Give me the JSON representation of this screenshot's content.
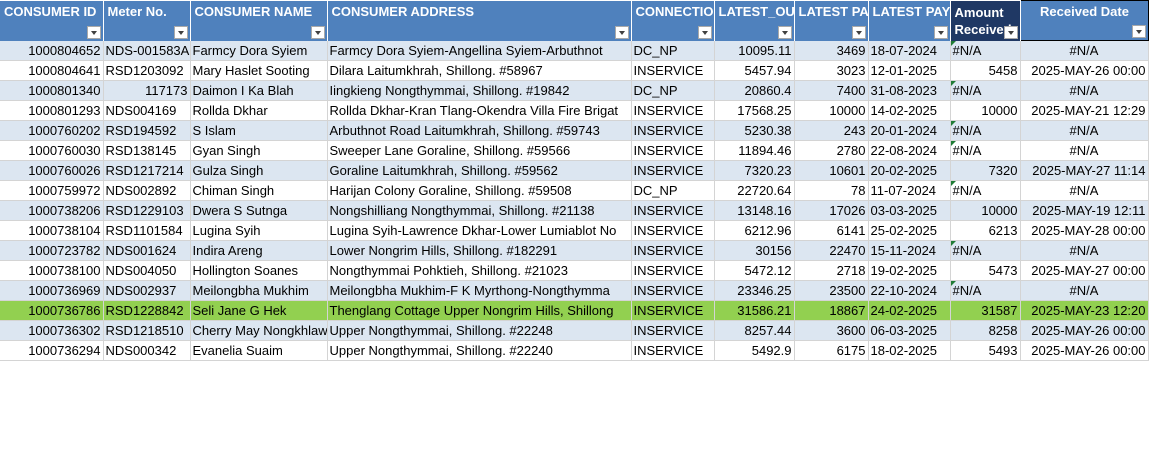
{
  "columns": [
    {
      "label": "CONSUMER ID"
    },
    {
      "label": "Meter No."
    },
    {
      "label": "CONSUMER NAME"
    },
    {
      "label": "CONSUMER ADDRESS"
    },
    {
      "label": "CONNECTION"
    },
    {
      "label": "LATEST_OUT"
    },
    {
      "label": "LATEST PAY"
    },
    {
      "label": "LATEST PAYM"
    },
    {
      "label": "Amount Received"
    },
    {
      "label": "Received Date"
    }
  ],
  "rows": [
    {
      "id": "1000804652",
      "meter": "NDS-001583A",
      "name": "Farmcy Dora Syiem",
      "address": "Farmcy Dora Syiem-Angellina Syiem-Arbuthnot",
      "conn": "DC_NP",
      "out": "10095.11",
      "pay": "3469",
      "date": "18-07-2024",
      "amount": "#N/A",
      "received": "#N/A"
    },
    {
      "id": "1000804641",
      "meter": "RSD1203092",
      "name": "Mary Haslet Sooting",
      "address": "Dilara Laitumkhrah, Shillong.  #58967",
      "conn": "INSERVICE",
      "out": "5457.94",
      "pay": "3023",
      "date": "12-01-2025",
      "amount": "5458",
      "received": "2025-MAY-26 00:00"
    },
    {
      "id": "1000801340",
      "meter": "117173",
      "name": "Daimon I Ka Blah",
      "address": "Iingkieng Nongthymmai, Shillong.  #19842",
      "conn": "DC_NP",
      "out": "20860.4",
      "pay": "7400",
      "date": "31-08-2023",
      "amount": "#N/A",
      "received": "#N/A"
    },
    {
      "id": "1000801293",
      "meter": "NDS004169",
      "name": "Rollda Dkhar",
      "address": "Rollda Dkhar-Kran Tlang-Okendra Villa Fire Brigat",
      "conn": "INSERVICE",
      "out": "17568.25",
      "pay": "10000",
      "date": "14-02-2025",
      "amount": "10000",
      "received": "2025-MAY-21 12:29"
    },
    {
      "id": "1000760202",
      "meter": "RSD194592",
      "name": "S  Islam",
      "address": "Arbuthnot Road Laitumkhrah, Shillong.  #59743",
      "conn": "INSERVICE",
      "out": "5230.38",
      "pay": "243",
      "date": "20-01-2024",
      "amount": "#N/A",
      "received": "#N/A"
    },
    {
      "id": "1000760030",
      "meter": "RSD138145",
      "name": "Gyan  Singh",
      "address": "Sweeper Lane Goraline, Shillong.  #59566",
      "conn": "INSERVICE",
      "out": "11894.46",
      "pay": "2780",
      "date": "22-08-2024",
      "amount": "#N/A",
      "received": "#N/A"
    },
    {
      "id": "1000760026",
      "meter": "RSD1217214",
      "name": "Gulza  Singh",
      "address": "Goraline Laitumkhrah, Shillong.  #59562",
      "conn": "INSERVICE",
      "out": "7320.23",
      "pay": "10601",
      "date": "20-02-2025",
      "amount": "7320",
      "received": "2025-MAY-27 11:14"
    },
    {
      "id": "1000759972",
      "meter": "NDS002892",
      "name": "Chiman  Singh",
      "address": "Harijan Colony Goraline, Shillong.  #59508",
      "conn": "DC_NP",
      "out": "22720.64",
      "pay": "78",
      "date": "11-07-2024",
      "amount": "#N/A",
      "received": "#N/A"
    },
    {
      "id": "1000738206",
      "meter": "RSD1229103",
      "name": "Dwera S Sutnga",
      "address": "Nongshilliang Nongthymmai, Shillong.  #21138",
      "conn": "INSERVICE",
      "out": "13148.16",
      "pay": "17026",
      "date": "03-03-2025",
      "amount": "10000",
      "received": "2025-MAY-19 12:11"
    },
    {
      "id": "1000738104",
      "meter": "RSD1101584",
      "name": "Lugina Syih",
      "address": "Lugina Syih-Lawrence Dkhar-Lower Lumiablot No",
      "conn": "INSERVICE",
      "out": "6212.96",
      "pay": "6141",
      "date": "25-02-2025",
      "amount": "6213",
      "received": "2025-MAY-28 00:00"
    },
    {
      "id": "1000723782",
      "meter": "NDS001624",
      "name": "Indira  Areng",
      "address": "Lower Nongrim Hills, Shillong.  #182291",
      "conn": "INSERVICE",
      "out": "30156",
      "pay": "22470",
      "date": "15-11-2024",
      "amount": "#N/A",
      "received": "#N/A"
    },
    {
      "id": "1000738100",
      "meter": "NDS004050",
      "name": "Hollington  Soanes",
      "address": "Nongthymmai Pohktieh, Shillong.  #21023",
      "conn": "INSERVICE",
      "out": "5472.12",
      "pay": "2718",
      "date": "19-02-2025",
      "amount": "5473",
      "received": "2025-MAY-27 00:00"
    },
    {
      "id": "1000736969",
      "meter": "NDS002937",
      "name": "Meilongbha Mukhim",
      "address": "Meilongbha Mukhim-F K Myrthong-Nongthymma",
      "conn": "INSERVICE",
      "out": "23346.25",
      "pay": "23500",
      "date": "22-10-2024",
      "amount": "#N/A",
      "received": "#N/A"
    },
    {
      "id": "1000736786",
      "meter": "RSD1228842",
      "name": "Seli Jane G Hek",
      "address": "Thenglang Cottage Upper Nongrim Hills, Shillong",
      "conn": "INSERVICE",
      "out": "31586.21",
      "pay": "18867",
      "date": "24-02-2025",
      "amount": "31587",
      "received": "2025-MAY-23 12:20"
    },
    {
      "id": "1000736302",
      "meter": "RSD1218510",
      "name": "Cherry May Nongkhlaw",
      "address": "Upper Nongthymmai, Shillong.  #22248",
      "conn": "INSERVICE",
      "out": "8257.44",
      "pay": "3600",
      "date": "06-03-2025",
      "amount": "8258",
      "received": "2025-MAY-26 00:00"
    },
    {
      "id": "1000736294",
      "meter": "NDS000342",
      "name": "Evanelia Suaim",
      "address": "Upper Nongthymmai, Shillong.  #22240",
      "conn": "INSERVICE",
      "out": "5492.9",
      "pay": "6175",
      "date": "18-02-2025",
      "amount": "5493",
      "received": "2025-MAY-26 00:00"
    }
  ]
}
